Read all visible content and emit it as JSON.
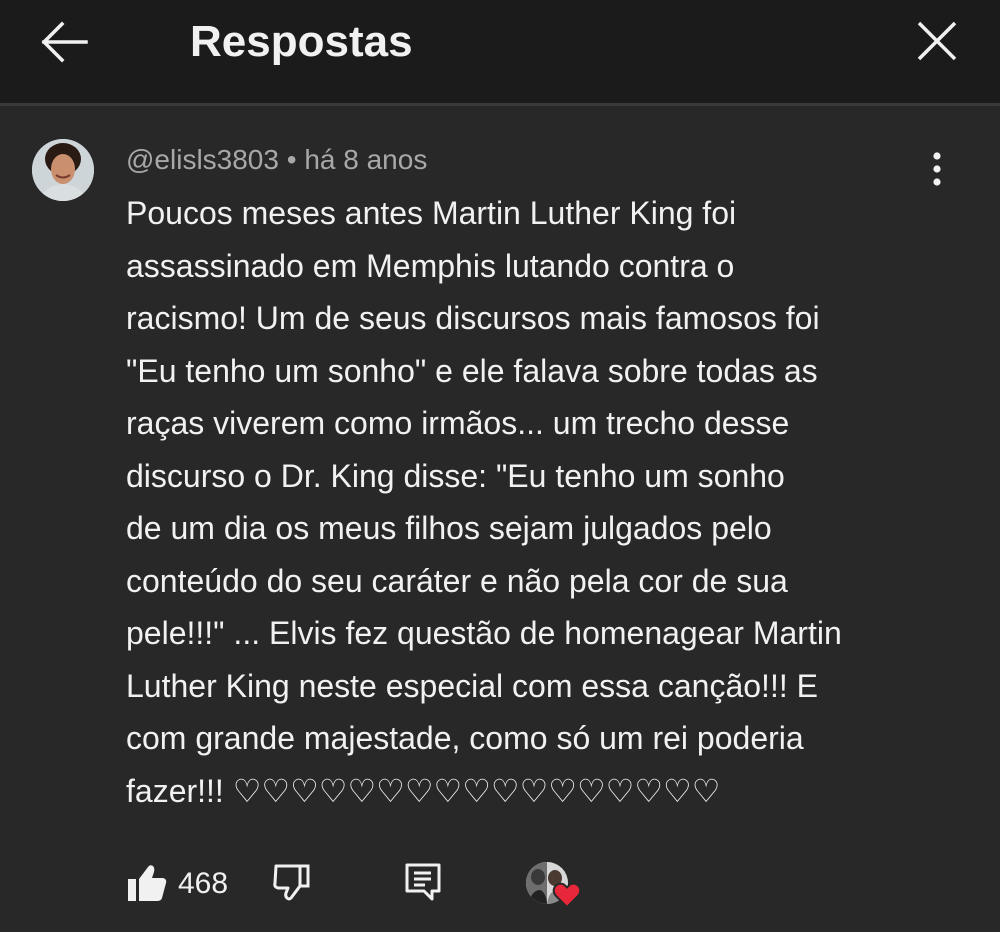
{
  "header": {
    "title": "Respostas",
    "back_icon": "arrow-left-icon",
    "close_icon": "close-icon"
  },
  "comment": {
    "author": "@elisls3803",
    "separator": "•",
    "time": "há 8 anos",
    "lines": [
      "Poucos meses antes Martin Luther King foi",
      "assassinado em Memphis lutando contra o",
      "racismo! Um de seus discursos mais famosos foi",
      "\"Eu tenho um sonho\" e ele falava sobre todas as",
      "raças viverem como irmãos... um trecho desse",
      "discurso o Dr. King disse: \"Eu tenho um sonho",
      "de um dia os meus filhos sejam julgados pelo",
      "conteúdo do seu caráter e não pela cor de sua",
      "pele!!!\" ... Elvis fez questão de homenagear Martin",
      "Luther King neste especial com essa canção!!! E",
      "com grande majestade, como só um rei poderia",
      "fazer!!! ♡♡♡♡♡♡♡♡♡♡♡♡♡♡♡♡♡"
    ],
    "like_count": "468"
  },
  "colors": {
    "background": "#282828",
    "header_background": "#1b1b1b",
    "text": "#f1f1f1",
    "meta_text": "#a8a8a8",
    "heart": "#e8283a"
  }
}
